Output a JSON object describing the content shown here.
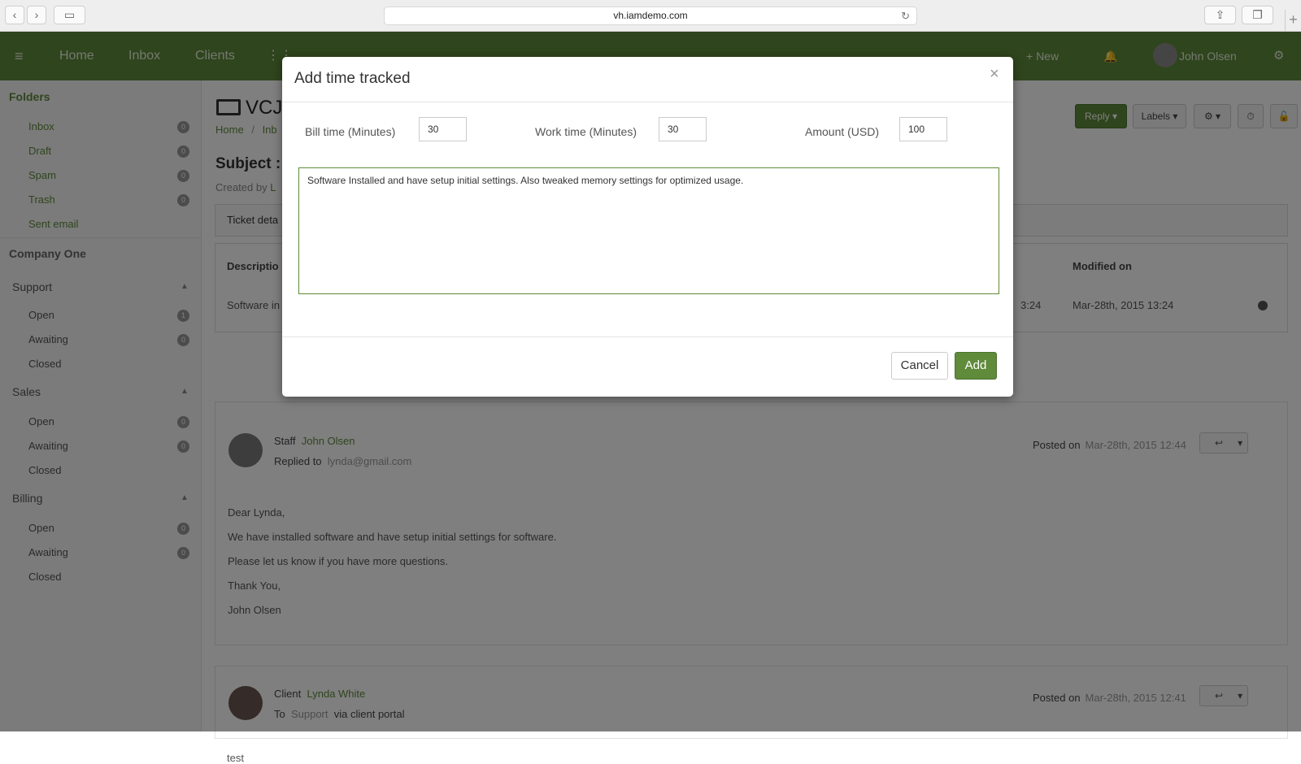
{
  "browser": {
    "url": "vh.iamdemo.com"
  },
  "nav": {
    "home": "Home",
    "inbox": "Inbox",
    "clients": "Clients",
    "new": "+ New",
    "user": "John Olsen"
  },
  "sidebar": {
    "folders_title": "Folders",
    "folders": [
      {
        "label": "Inbox",
        "count": "0"
      },
      {
        "label": "Draft",
        "count": "0"
      },
      {
        "label": "Spam",
        "count": "0"
      },
      {
        "label": "Trash",
        "count": "0"
      },
      {
        "label": "Sent email"
      }
    ],
    "company": "Company One",
    "groups": [
      {
        "name": "Support",
        "items": [
          {
            "label": "Open",
            "count": "1"
          },
          {
            "label": "Awaiting",
            "count": "0"
          },
          {
            "label": "Closed"
          }
        ]
      },
      {
        "name": "Sales",
        "items": [
          {
            "label": "Open",
            "count": "0"
          },
          {
            "label": "Awaiting",
            "count": "0"
          },
          {
            "label": "Closed"
          }
        ]
      },
      {
        "name": "Billing",
        "items": [
          {
            "label": "Open",
            "count": "0"
          },
          {
            "label": "Awaiting",
            "count": "0"
          },
          {
            "label": "Closed"
          }
        ]
      }
    ]
  },
  "ticket": {
    "title": "VCJI",
    "crumb_home": "Home",
    "crumb_sep": "/",
    "crumb_inbox": "Inb",
    "subject": "Subject :",
    "created_by": "Created by",
    "created_by_initial": "L",
    "tab": "Ticket deta",
    "col_description": "Descriptio",
    "col_modified": "Modified on",
    "row_description": "Software in",
    "row_time_partial": "3:24",
    "row_modified": "Mar-28th, 2015 13:24"
  },
  "toolbar": {
    "reply": "Reply ▾",
    "labels": "Labels ▾",
    "settings": "⚙ ▾",
    "timer": "⏱",
    "lock": "🔓"
  },
  "posts": [
    {
      "role": "Staff",
      "name": "John Olsen",
      "line2_label": "Replied to",
      "line2_value": "lynda@gmail.com",
      "posted_label": "Posted on",
      "posted_value": "Mar-28th, 2015 12:44",
      "body": [
        "Dear Lynda,",
        "We have installed software and have setup initial settings for software.",
        "Please let us know if you have more questions.",
        "Thank You,",
        "John Olsen"
      ]
    },
    {
      "role": "Client",
      "name": "Lynda White",
      "line2_label": "To",
      "line2_value": "Support",
      "line2_suffix": "via client portal",
      "posted_label": "Posted on",
      "posted_value": "Mar-28th, 2015 12:41",
      "body": [
        "test"
      ]
    }
  ],
  "modal": {
    "title": "Add time tracked",
    "close": "×",
    "bill_label": "Bill time (Minutes)",
    "bill_value": "30",
    "work_label": "Work time (Minutes)",
    "work_value": "30",
    "amount_label": "Amount (USD)",
    "amount_value": "100",
    "description": "Software Installed and have setup initial settings. Also tweaked memory settings for optimized usage.",
    "cancel": "Cancel",
    "add": "Add"
  },
  "colors": {
    "brand": "#5f8b3a",
    "overlay": "rgba(0,0,0,0.5)"
  }
}
